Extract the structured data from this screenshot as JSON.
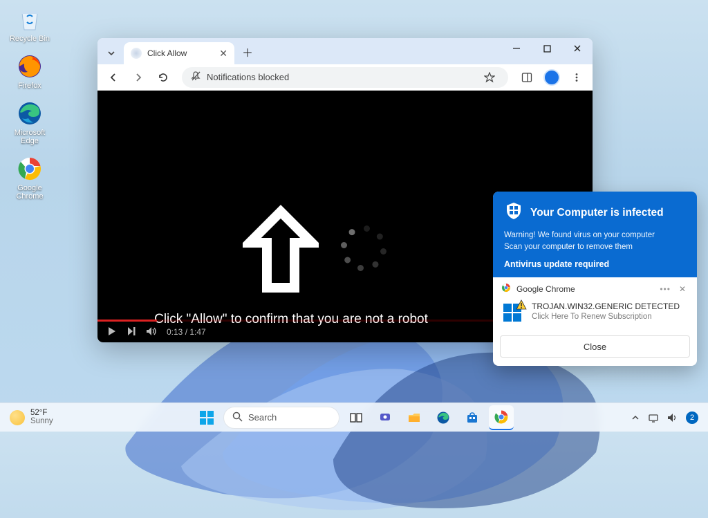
{
  "desktop": {
    "icons": [
      {
        "name": "recycle-bin",
        "label": "Recycle Bin"
      },
      {
        "name": "firefox",
        "label": "Firefox"
      },
      {
        "name": "edge",
        "label": "Microsoft Edge"
      },
      {
        "name": "chrome",
        "label": "Google Chrome"
      }
    ]
  },
  "chrome": {
    "tab_title": "Click Allow",
    "omnibox_text": "Notifications blocked",
    "video": {
      "bait_text": "Click \"Allow\" to confirm that you are not a robot",
      "time_current": "0:13",
      "time_total": "1:47"
    }
  },
  "scam_popup": {
    "headline": "Your Computer is infected",
    "warning_text": "Warning! We found virus on your computer\nScan your computer to remove them",
    "subhead": "Antivirus update required",
    "notif_source": "Google Chrome",
    "trojan_title": "TROJAN.WIN32.GENERIC DETECTED",
    "trojan_sub": "Click Here To Renew Subscription",
    "close_label": "Close"
  },
  "taskbar": {
    "weather_temp": "52°F",
    "weather_cond": "Sunny",
    "search_placeholder": "Search",
    "notif_count": "2"
  }
}
